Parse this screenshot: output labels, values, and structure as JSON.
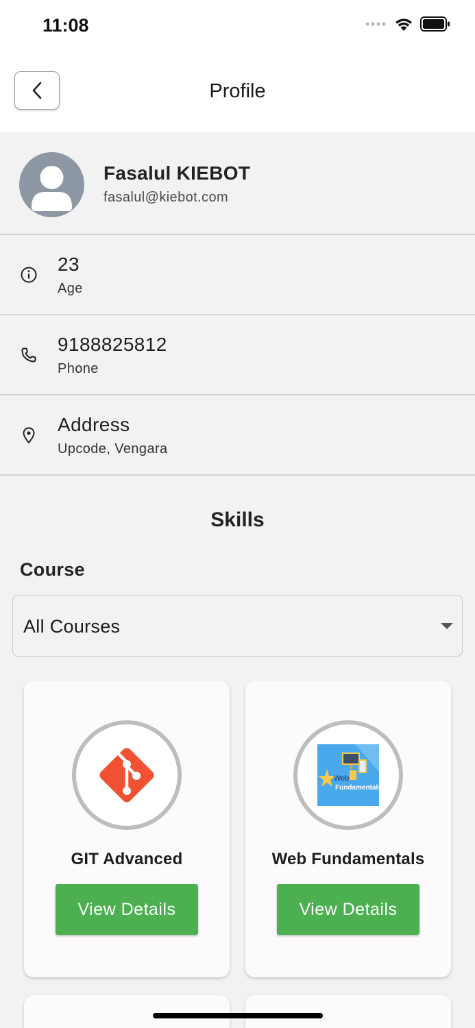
{
  "status_bar": {
    "time": "11:08"
  },
  "header": {
    "title": "Profile"
  },
  "profile": {
    "name": "Fasalul KIEBOT",
    "email": "fasalul@kiebot.com"
  },
  "info_rows": [
    {
      "value": "23",
      "label": "Age",
      "icon": "info-icon"
    },
    {
      "value": "9188825812",
      "label": "Phone",
      "icon": "phone-icon"
    },
    {
      "value": "Address",
      "label": "Upcode, Vengara",
      "icon": "location-pin-icon"
    }
  ],
  "skills": {
    "title": "Skills",
    "course_label": "Course",
    "course_select": {
      "value": "All Courses"
    },
    "cards": [
      {
        "title": "GIT Advanced",
        "button": "View Details",
        "icon": "git-logo-icon"
      },
      {
        "title": "Web Fundamentals",
        "button": "View Details",
        "icon": "web-fundamentals-thumbnail",
        "thumb_text_1": "Web",
        "thumb_text_2": "Fundamentals"
      }
    ]
  },
  "colors": {
    "accent": "#4caf50",
    "avatar": "#8e97a4",
    "git": "#f05133"
  }
}
